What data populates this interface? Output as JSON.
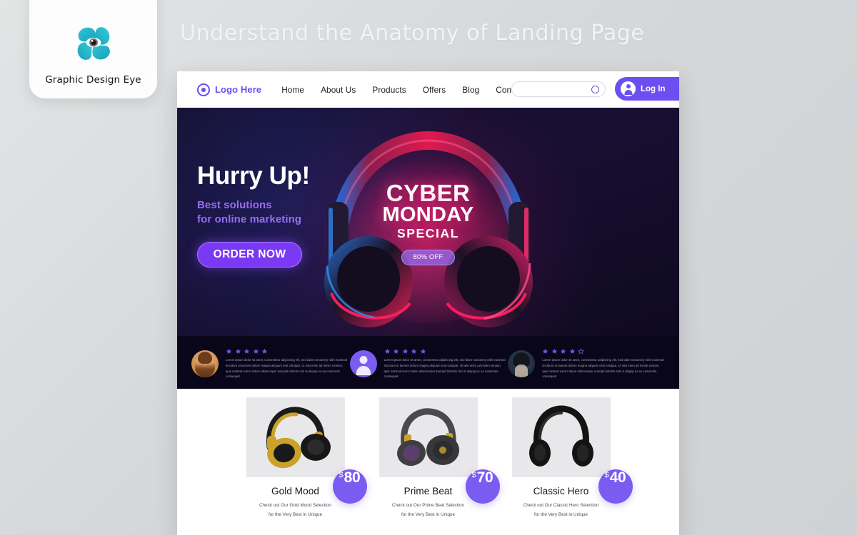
{
  "brand": {
    "logo_icon": "pinwheel-eye-logo",
    "name": "Graphic Design Eye"
  },
  "page": {
    "title": "Understand the Anatomy of Landing Page"
  },
  "colors": {
    "accent_purple": "#6c4ff0",
    "bright_purple": "#7a39f2",
    "badge_purple": "#7b5cf0",
    "star_purple": "#6b5ce7",
    "hero_dark": "#150f2c",
    "testimonial_dark": "#09061a",
    "brand_teal": "#23b6c8",
    "page_bg": "#d7d9db"
  },
  "navbar": {
    "logo_text": "Logo Here",
    "links": [
      {
        "label": "Home"
      },
      {
        "label": "About Us"
      },
      {
        "label": "Products"
      },
      {
        "label": "Offers"
      },
      {
        "label": "Blog"
      },
      {
        "label": "Contact"
      }
    ],
    "search": {
      "value": "",
      "placeholder": ""
    },
    "login_label": "Log In"
  },
  "hero": {
    "heading": "Hurry Up!",
    "subheading_line1": "Best solutions",
    "subheading_line2": "for online marketing",
    "cta_label": "ORDER NOW",
    "promo_line1": "CYBER",
    "promo_line2": "MONDAY",
    "promo_line3": "SPECIAL",
    "discount_badge": "80% OFF"
  },
  "testimonials": [
    {
      "avatar": "woman-photo-avatar",
      "rating": 5,
      "max_rating": 5,
      "text": "Lorem ipsum dolor sit amet, consectetur adipiscing elit, sed diam nonummy nibh euismod tincidunt ut laoreet dolore magna aliquam erat volutpat. Ut wisi enim ad minim veniam, quis nostrud exerci tation ullamcorper suscipit lobortis nisl ut aliquip ex ea commodo consequat."
    },
    {
      "avatar": "user-silhouette-icon",
      "rating": 5,
      "max_rating": 5,
      "text": "Lorem ipsum dolor sit amet, consectetur adipiscing elit, sed diam nonummy nibh euismod tincidunt ut laoreet dolore magna aliquam erat volutpat. Ut wisi enim ad minim veniam, quis nostrud exerci tation ullamcorper suscipit lobortis nisl ut aliquip ex ea commodo consequat."
    },
    {
      "avatar": "dark-portrait-avatar",
      "rating": 4,
      "max_rating": 5,
      "text": "Lorem ipsum dolor sit amet, consectetur adipiscing elit, sed diam nonummy nibh euismod tincidunt ut laoreet dolore magna aliquam erat volutpat. Ut wisi enim ad minim veniam, quis nostrud exerci tation ullamcorper suscipit lobortis nisl ut aliquip ex ea commodo consequat."
    }
  ],
  "products": [
    {
      "name": "Gold Mood",
      "price_currency": "$",
      "price_value": "80",
      "desc_line1": "Check out Our Gold Mood Selection",
      "desc_line2": "for the Very Best in Unique",
      "image": "gold-black-headphones"
    },
    {
      "name": "Prime Beat",
      "price_currency": "$",
      "price_value": "70",
      "desc_line1": "Check out Our Prime Beat Selection",
      "desc_line2": "for the Very Best in Unique",
      "image": "gray-headphones"
    },
    {
      "name": "Classic Hero",
      "price_currency": "$",
      "price_value": "40",
      "desc_line1": "Check out Our Classic Hero Selection",
      "desc_line2": "for the Very Best in Unique",
      "image": "black-headphones"
    }
  ]
}
